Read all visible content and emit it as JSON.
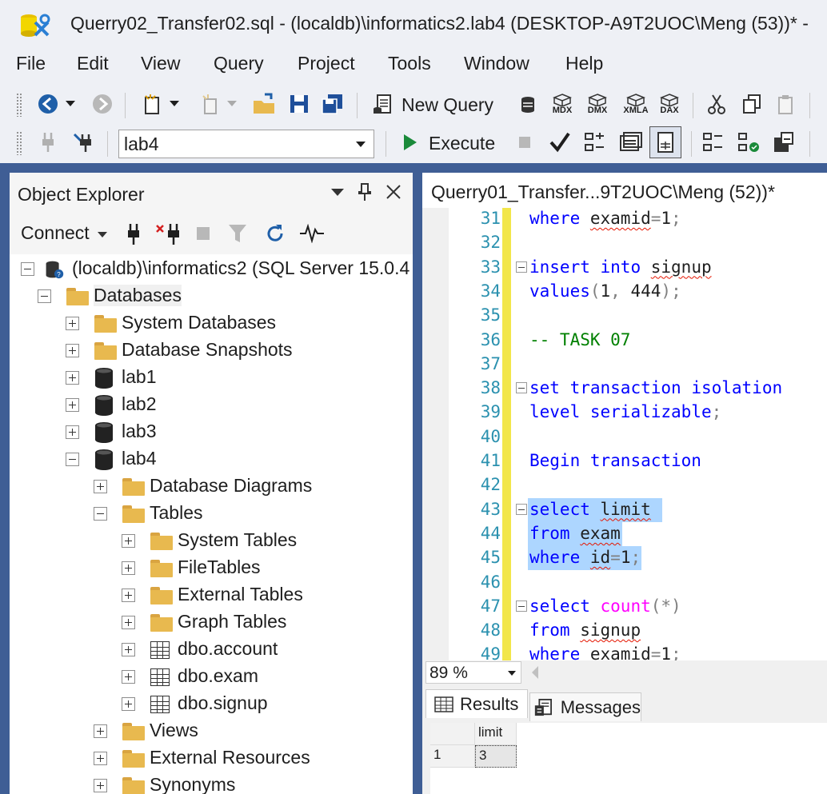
{
  "window": {
    "title": "Querry02_Transfer02.sql - (localdb)\\informatics2.lab4 (DESKTOP-A9T2UOC\\Meng (53))* -"
  },
  "menu": [
    "File",
    "Edit",
    "View",
    "Query",
    "Project",
    "Tools",
    "Window",
    "Help"
  ],
  "toolbar": {
    "new_query_label": "New Query",
    "mdx": "MDX",
    "dmx": "DMX",
    "xmla": "XMLA",
    "dax": "DAX",
    "database_selected": "lab4",
    "execute_label": "Execute"
  },
  "object_explorer": {
    "title": "Object Explorer",
    "connect_label": "Connect",
    "server": "(localdb)\\informatics2 (SQL Server 15.0.4",
    "tree": [
      {
        "label": "Databases",
        "level": 1,
        "type": "folder",
        "expanded": true
      },
      {
        "label": "System Databases",
        "level": 2,
        "type": "folder"
      },
      {
        "label": "Database Snapshots",
        "level": 2,
        "type": "folder"
      },
      {
        "label": "lab1",
        "level": 2,
        "type": "db"
      },
      {
        "label": "lab2",
        "level": 2,
        "type": "db"
      },
      {
        "label": "lab3",
        "level": 2,
        "type": "db"
      },
      {
        "label": "lab4",
        "level": 2,
        "type": "db",
        "expanded": true
      },
      {
        "label": "Database Diagrams",
        "level": 3,
        "type": "folder"
      },
      {
        "label": "Tables",
        "level": 3,
        "type": "folder",
        "expanded": true
      },
      {
        "label": "System Tables",
        "level": 4,
        "type": "folder"
      },
      {
        "label": "FileTables",
        "level": 4,
        "type": "folder"
      },
      {
        "label": "External Tables",
        "level": 4,
        "type": "folder"
      },
      {
        "label": "Graph Tables",
        "level": 4,
        "type": "folder"
      },
      {
        "label": "dbo.account",
        "level": 4,
        "type": "table"
      },
      {
        "label": "dbo.exam",
        "level": 4,
        "type": "table"
      },
      {
        "label": "dbo.signup",
        "level": 4,
        "type": "table"
      },
      {
        "label": "Views",
        "level": 3,
        "type": "folder"
      },
      {
        "label": "External Resources",
        "level": 3,
        "type": "folder"
      },
      {
        "label": "Synonyms",
        "level": 3,
        "type": "folder"
      }
    ]
  },
  "editor": {
    "tab_title": "Querry01_Transfer...9T2UOC\\Meng (52))*",
    "zoom": "89 %",
    "lines": [
      {
        "n": "31",
        "text": "where examid=1;"
      },
      {
        "n": "32",
        "text": ""
      },
      {
        "n": "33",
        "text": "insert into signup"
      },
      {
        "n": "34",
        "text": "values(1, 444);"
      },
      {
        "n": "35",
        "text": ""
      },
      {
        "n": "36",
        "text": "-- TASK 07"
      },
      {
        "n": "37",
        "text": ""
      },
      {
        "n": "38",
        "text": "set transaction isolation"
      },
      {
        "n": "39",
        "text": "level serializable;"
      },
      {
        "n": "40",
        "text": ""
      },
      {
        "n": "41",
        "text": "Begin transaction"
      },
      {
        "n": "42",
        "text": ""
      },
      {
        "n": "43",
        "text": "select limit"
      },
      {
        "n": "44",
        "text": "from exam"
      },
      {
        "n": "45",
        "text": "where id=1;"
      },
      {
        "n": "46",
        "text": ""
      },
      {
        "n": "47",
        "text": "select count(*)"
      },
      {
        "n": "48",
        "text": "from signup"
      },
      {
        "n": "49",
        "text": "where examid=1;"
      }
    ]
  },
  "results": {
    "tabs": [
      "Results",
      "Messages"
    ],
    "columns": [
      "limit"
    ],
    "rows": [
      {
        "row_num": "1",
        "values": [
          "3"
        ]
      }
    ]
  },
  "colors": {
    "frame": "#3f5e95",
    "keyword": "#0000ff",
    "function": "#ff00ff",
    "comment": "#008000",
    "line_number": "#2b91af",
    "selection": "#add6ff",
    "change_bar": "#f2e64a"
  }
}
